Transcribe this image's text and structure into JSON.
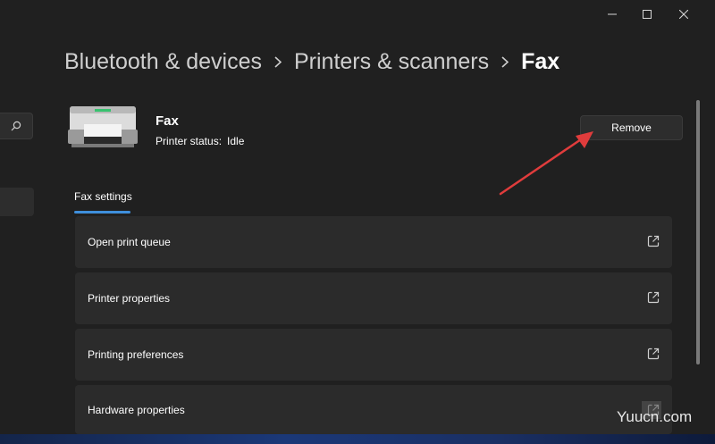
{
  "window": {
    "controls": {
      "minimize_icon": "minimize-icon",
      "maximize_icon": "maximize-icon",
      "close_icon": "close-icon"
    }
  },
  "sidebar": {
    "search_icon": "search-icon"
  },
  "breadcrumb": {
    "items": [
      "Bluetooth & devices",
      "Printers & scanners"
    ],
    "current": "Fax"
  },
  "printer": {
    "name": "Fax",
    "status_label": "Printer status:",
    "status_value": "Idle",
    "remove_label": "Remove"
  },
  "tabs": [
    {
      "label": "Fax settings",
      "selected": true
    }
  ],
  "settings": [
    {
      "label": "Open print queue",
      "icon": "open-external-icon"
    },
    {
      "label": "Printer properties",
      "icon": "open-external-icon"
    },
    {
      "label": "Printing preferences",
      "icon": "open-external-icon"
    },
    {
      "label": "Hardware properties",
      "icon": "open-external-icon"
    }
  ],
  "colors": {
    "background": "#202020",
    "card": "#2b2b2b",
    "accent": "#3f8fdc",
    "annotation": "#e03c3c"
  },
  "watermark": "Yuucn.com"
}
